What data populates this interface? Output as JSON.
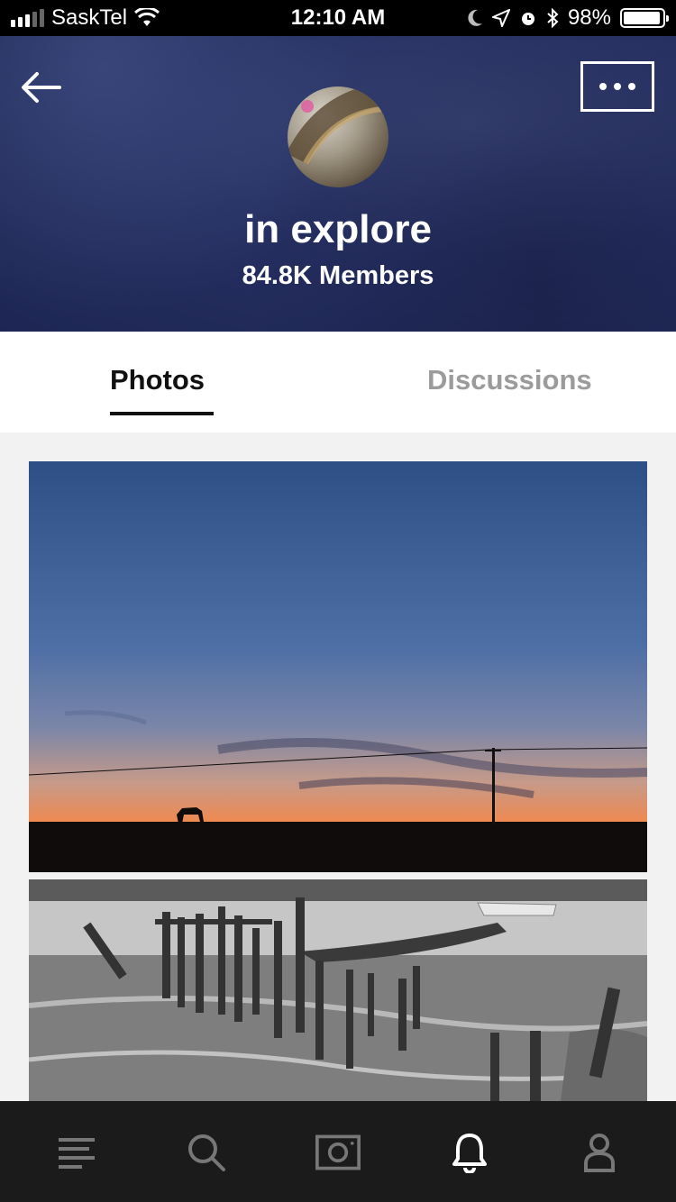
{
  "status_bar": {
    "carrier": "SaskTel",
    "time": "12:10 AM",
    "battery": "98%"
  },
  "header": {
    "title": "in explore",
    "members": "84.8K Members"
  },
  "tabs": [
    {
      "label": "Photos",
      "selected": true
    },
    {
      "label": "Discussions",
      "selected": false
    }
  ],
  "photos": [
    {
      "subject": "sunset-horse-silhouette"
    },
    {
      "subject": "shipwreck-pier-monochrome"
    }
  ],
  "bottom_nav": [
    {
      "icon": "feed-icon",
      "active": false
    },
    {
      "icon": "search-icon",
      "active": false
    },
    {
      "icon": "camera-icon",
      "active": false
    },
    {
      "icon": "bell-icon",
      "active": true
    },
    {
      "icon": "profile-icon",
      "active": false
    }
  ],
  "colors": {
    "header": "#263062",
    "tab_active": "#111111",
    "tab_inactive": "#9b9b9b",
    "nav_bg": "#121212"
  }
}
